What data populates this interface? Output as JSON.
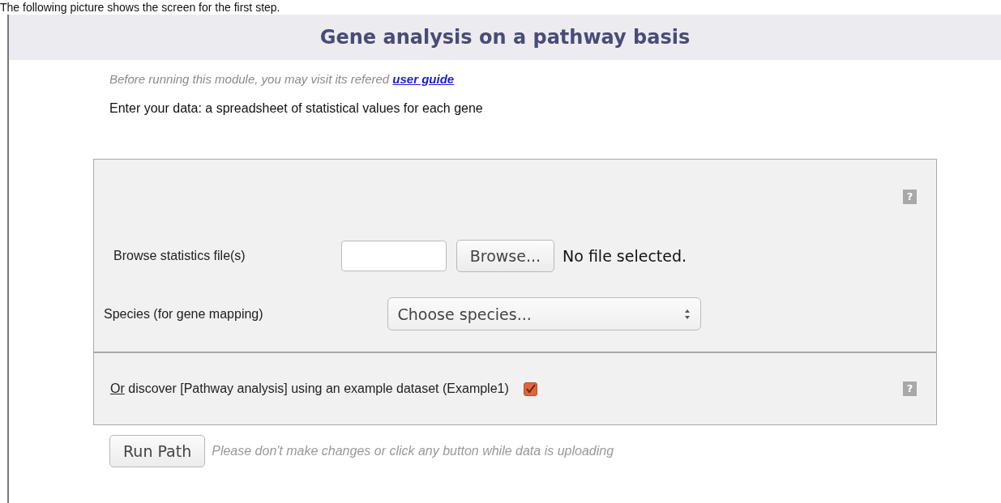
{
  "caption": "The following picture shows the screen for the first step.",
  "title": "Gene analysis on a pathway basis",
  "help_icons": [
    "?",
    "?"
  ],
  "intro": {
    "text": "Before running this module, you may visit its refered ",
    "link": "user guide"
  },
  "instruction": "Enter your data: a spreadsheet of statistical values for each gene",
  "upload": {
    "label": "Browse statistics file(s)",
    "button": "Browse...",
    "status": "No file selected."
  },
  "species": {
    "label": "Species (for gene mapping)",
    "value": "Choose species..."
  },
  "example": {
    "link": "Or",
    "text": " discover [Pathway analysis] using an example dataset (Example1)",
    "checked": true
  },
  "run": {
    "button": "Run Path",
    "note": "Please don't make changes or click any button while data is uploading"
  }
}
